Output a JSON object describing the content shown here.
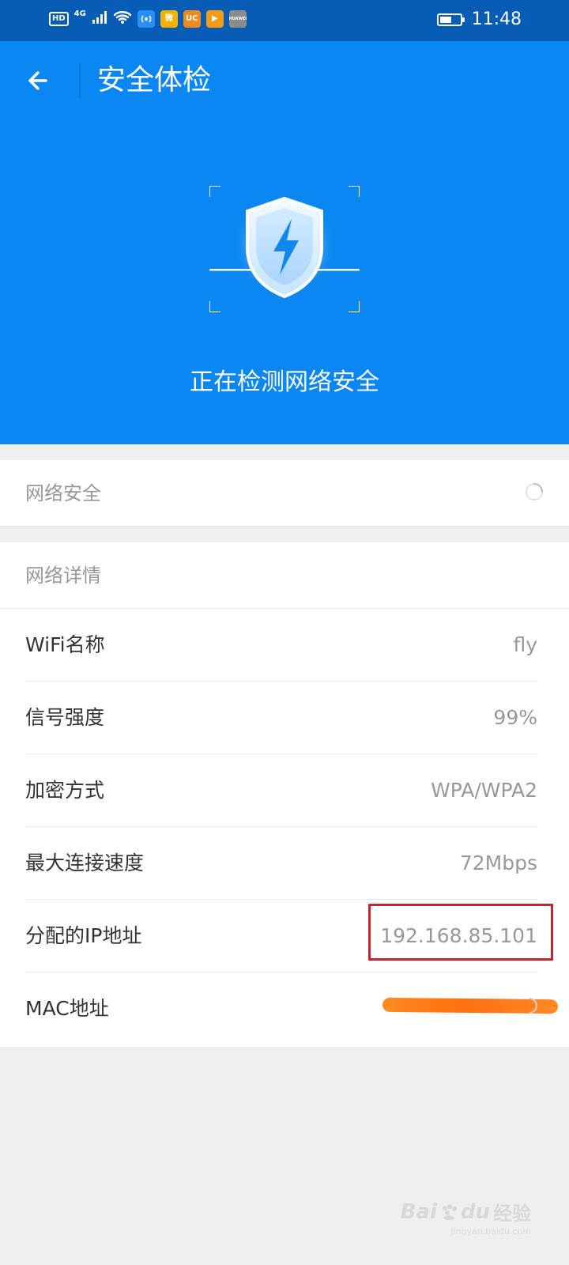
{
  "status_bar": {
    "network_badge": "HD",
    "network_type": "4G",
    "time": "11:48",
    "battery_level": 0.62,
    "apps": [
      {
        "name": "signal-app-icon",
        "text": "",
        "color": "#2690f5"
      },
      {
        "name": "weibo-icon",
        "text": "微",
        "color": "#f4b300"
      },
      {
        "name": "uc-browser-icon",
        "text": "UC",
        "color": "#f08a1d"
      },
      {
        "name": "video-app-icon",
        "text": "▶",
        "color": "#f79b16"
      },
      {
        "name": "huawei-icon",
        "text": "HUAWEI",
        "color": "#8c8c8c"
      }
    ]
  },
  "header": {
    "title": "安全体检"
  },
  "scan": {
    "status": "正在检测网络安全"
  },
  "security_section": {
    "title": "网络安全"
  },
  "details_section": {
    "title": "网络详情",
    "rows": [
      {
        "label": "WiFi名称",
        "value": "fly"
      },
      {
        "label": "信号强度",
        "value": "99%"
      },
      {
        "label": "加密方式",
        "value": "WPA/WPA2"
      },
      {
        "label": "最大连接速度",
        "value": "72Mbps"
      },
      {
        "label": "分配的IP地址",
        "value": "192.168.85.101"
      },
      {
        "label": "MAC地址",
        "value": ""
      }
    ]
  },
  "watermark": {
    "text": "Bai",
    "text2": "du",
    "label": "经验",
    "url": "jingyan.baidu.com"
  },
  "colors": {
    "header_blue": "#0a87f2",
    "status_blue": "#075db6",
    "highlight_red": "#c4252c",
    "redaction_orange": "#ff7a16"
  }
}
